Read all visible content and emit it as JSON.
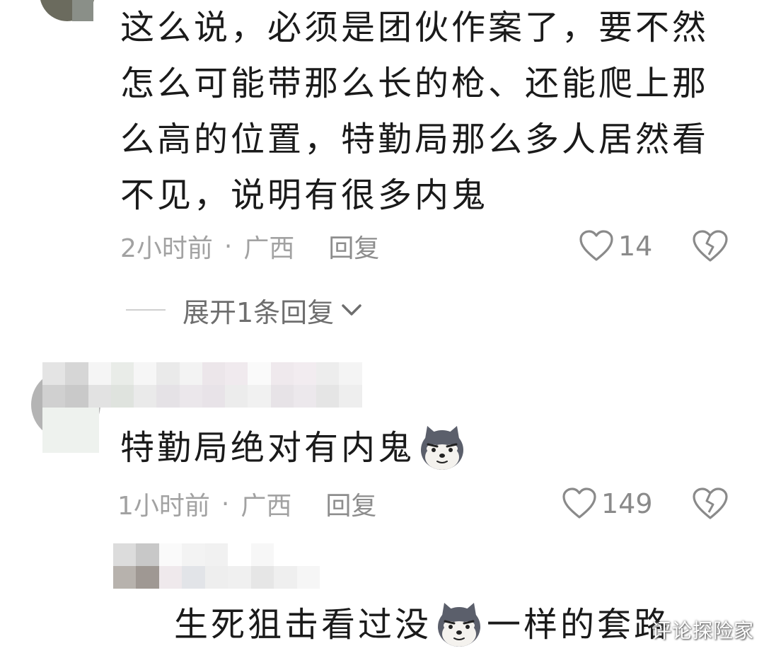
{
  "comments": [
    {
      "text": "这么说，必须是团伙作案了，要不然怎么可能带那么长的枪、还能爬上那么高的位置，特勤局那么多人居然看不见，说明有很多内鬼",
      "time": "2小时前",
      "location": "广西",
      "reply_label": "回复",
      "likes": "14",
      "expand_label": "展开1条回复"
    },
    {
      "text": "特勤局绝对有内鬼",
      "time": "1小时前",
      "location": "广西",
      "reply_label": "回复",
      "likes": "149"
    },
    {
      "text": "生死狙击看过没",
      "text_after_emoji": "一样的套路"
    }
  ],
  "meta_separator": "·",
  "watermark": "评论探险家",
  "icons": [
    "heart-outline-icon",
    "broken-heart-icon",
    "chevron-down-icon",
    "dog-emoji-icon"
  ],
  "colors": {
    "text": "#1a1a1a",
    "meta": "#a2a2a2",
    "icon": "#8a8a8a"
  }
}
